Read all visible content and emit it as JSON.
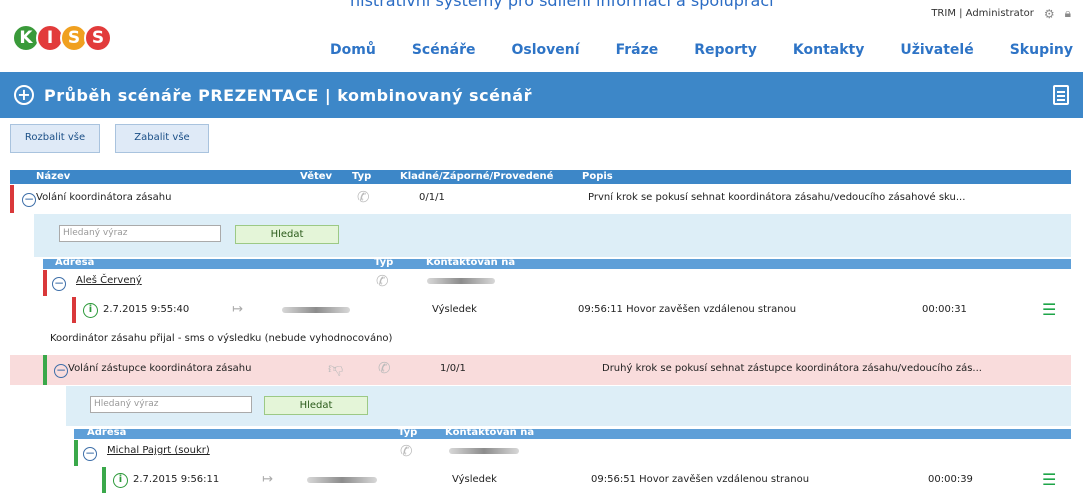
{
  "app": {
    "logo_letters": [
      "K",
      "I",
      "S",
      "S"
    ],
    "logo_colors": [
      "#3a9a3a",
      "#e23b3b",
      "#f0a020",
      "#e23b3b"
    ],
    "top_text": "nistrativní systémy pro sdílení informací a spolupráci"
  },
  "user": {
    "label": "TRIM | Administrator",
    "settings_icon": "gear-icon",
    "logout_icon": "lock-icon"
  },
  "nav": [
    "Domů",
    "Scénáře",
    "Oslovení",
    "Fráze",
    "Reporty",
    "Kontakty",
    "Uživatelé",
    "Skupiny"
  ],
  "title": "Průběh scénáře PREZENTACE | kombinovaný scénář",
  "buttons": {
    "expand_all": "Rozbalit vše",
    "collapse_all": "Zabalit vše"
  },
  "table_header": {
    "name": "Název",
    "branch": "Větev",
    "type": "Typ",
    "stats": "Kladné/Záporné/Provedené",
    "desc": "Popis"
  },
  "steps": [
    {
      "name": "Volání koordinátora zásahu",
      "stats": "0/1/1",
      "desc": "První krok se pokusí sehnat koordinátora zásahu/vedoucího zásahové sku...",
      "status_color": "#d9383a",
      "search_placeholder": "Hledaný výraz",
      "search_button": "Hledat",
      "sub_header": {
        "address": "Adresa",
        "type": "Typ",
        "contacted": "Kontaktován na"
      },
      "contact": "Aleš Červený",
      "attempt": {
        "time": "2.7.2015 9:55:40",
        "result_label": "Výsledek",
        "result": "09:56:11 Hovor zavěšen vzdálenou stranou",
        "duration": "00:00:31"
      },
      "note": "Koordinátor zásahu přijal - sms o výsledku (nebude vyhodnocováno)"
    },
    {
      "name": "Volání zástupce koordinátora zásahu",
      "stats": "1/0/1",
      "desc": "Druhý krok se pokusí sehnat zástupce koordinátora zásahu/vedoucího zás...",
      "status_color": "#3aa84a",
      "search_placeholder": "Hledaný výraz",
      "search_button": "Hledat",
      "sub_header": {
        "address": "Adresa",
        "type": "Typ",
        "contacted": "Kontaktován na"
      },
      "contact": "Michal Pajgrt (soukr)",
      "attempt": {
        "time": "2.7.2015 9:56:11",
        "result_label": "Výsledek",
        "result": "09:56:51 Hovor zavěšen vzdálenou stranou",
        "duration": "00:00:39"
      }
    }
  ],
  "colors": {
    "accent": "#3d87c8",
    "nav_link": "#2e74c6",
    "fail": "#d9383a",
    "success": "#3aa84a",
    "fail_bg": "#f9dcdc",
    "search_bg": "#ddeef7"
  }
}
